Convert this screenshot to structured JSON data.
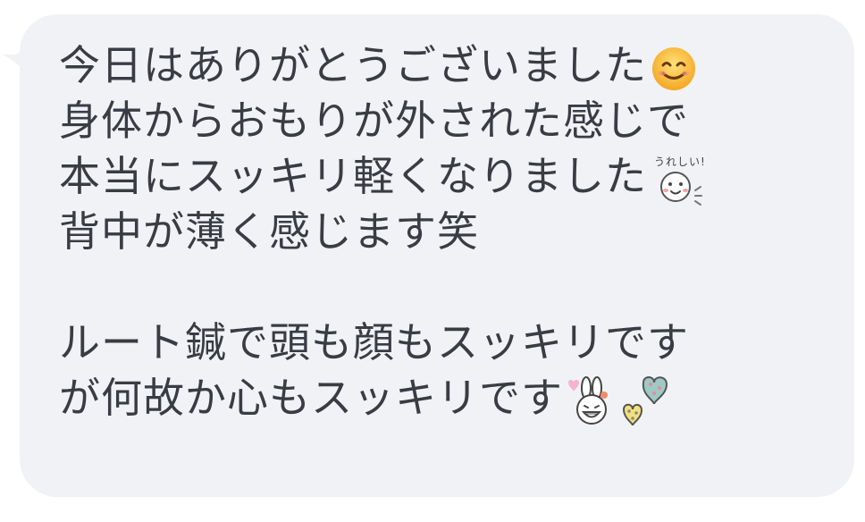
{
  "chat_bubble": {
    "lines": [
      "今日はありがとうございました",
      "身体からおもりが外された感じで",
      "本当にスッキリ軽くなりました",
      "背中が薄く感じます笑",
      "ルート鍼で頭も顔もスッキリです",
      "が何故か心もスッキリです"
    ],
    "sticker_text": "うれしい!",
    "icons": {
      "line1": "smiling-face-emoji",
      "line3": "happy-face-sticker-emoji",
      "line6_a": "bunny-face-emoji",
      "line6_b": "hearts-emoji"
    },
    "colors": {
      "bubble_bg": "#f1f2f6",
      "text": "#3a3c44"
    }
  }
}
